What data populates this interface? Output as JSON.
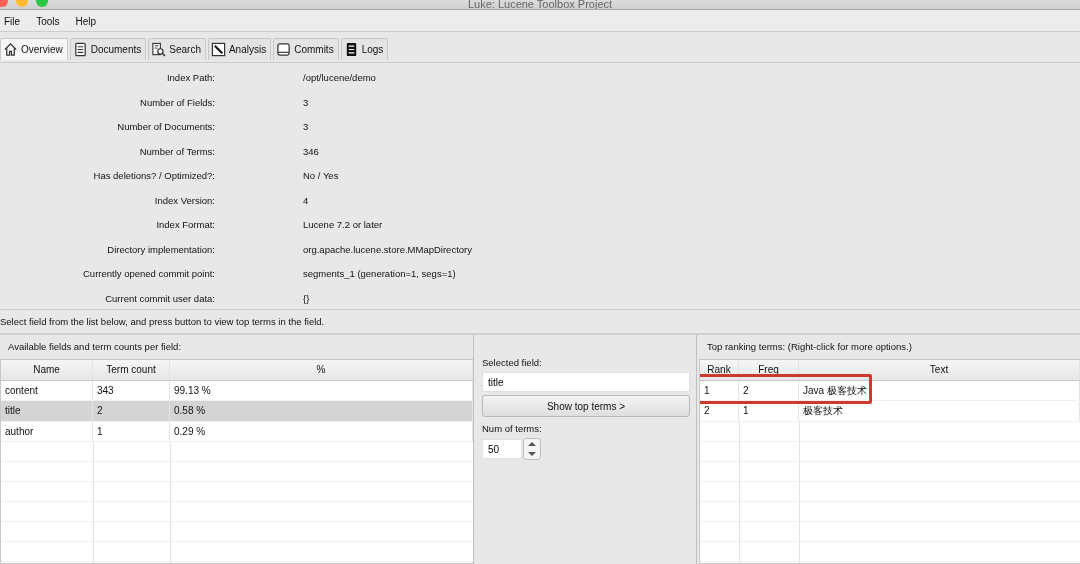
{
  "window": {
    "title": "Luke: Lucene Toolbox Project"
  },
  "menu": [
    "File",
    "Tools",
    "Help"
  ],
  "tabs": [
    {
      "label": "Overview",
      "kind": "house",
      "selected": true
    },
    {
      "label": "Documents",
      "kind": "document",
      "selected": false
    },
    {
      "label": "Search",
      "kind": "search",
      "selected": false
    },
    {
      "label": "Analysis",
      "kind": "analysis",
      "selected": false
    },
    {
      "label": "Commits",
      "kind": "drive",
      "selected": false
    },
    {
      "label": "Logs",
      "kind": "log",
      "selected": false
    }
  ],
  "overview": [
    {
      "label": "Index Path:",
      "value": "/opt/lucene/demo"
    },
    {
      "label": "Number of Fields:",
      "value": "3"
    },
    {
      "label": "Number of Documents:",
      "value": "3"
    },
    {
      "label": "Number of Terms:",
      "value": "346"
    },
    {
      "label": "Has deletions? / Optimized?:",
      "value": "No / Yes"
    },
    {
      "label": "Index Version:",
      "value": "4"
    },
    {
      "label": "Index Format:",
      "value": "Lucene 7.2 or later"
    },
    {
      "label": "Directory implementation:",
      "value": "org.apache.lucene.store.MMapDirectory"
    },
    {
      "label": "Currently opened commit point:",
      "value": "segments_1 (generation=1, segs=1)"
    },
    {
      "label": "Current commit user data:",
      "value": "{}"
    }
  ],
  "hint": "Select field from the list below, and press button to view top terms in the field.",
  "fields_panel": {
    "title": "Available fields and term counts per field:",
    "columns": [
      "Name",
      "Term count",
      "%"
    ],
    "rows": [
      {
        "cells": [
          "content",
          "343",
          "99.13 %"
        ],
        "selected": false
      },
      {
        "cells": [
          "title",
          "2",
          "0.58 %"
        ],
        "selected": true
      },
      {
        "cells": [
          "author",
          "1",
          "0.29 %"
        ],
        "selected": false
      }
    ]
  },
  "selection_panel": {
    "selected_field_label": "Selected field:",
    "selected_field": "title",
    "button": "Show top terms >",
    "num_label": "Num of terms:",
    "num_value": "50"
  },
  "terms_panel": {
    "title": "Top ranking terms: (Right-click for more options.)",
    "columns": [
      "Rank",
      "Freq",
      "Text"
    ],
    "rows": [
      {
        "cells": [
          "1",
          "2",
          "Java 极客技术"
        ],
        "highlighted": true
      },
      {
        "cells": [
          "2",
          "1",
          "极客技术"
        ],
        "highlighted": false
      }
    ]
  }
}
